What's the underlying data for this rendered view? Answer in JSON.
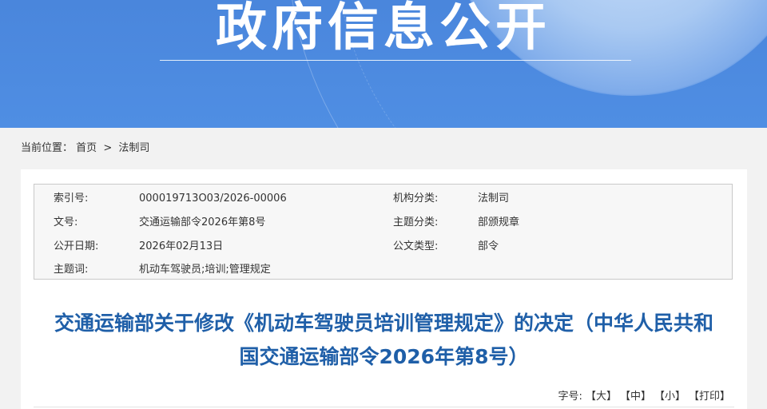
{
  "banner": {
    "title": "政府信息公开"
  },
  "breadcrumb": {
    "label": "当前位置：",
    "home": "首页",
    "sep": ">",
    "current": "法制司"
  },
  "meta": {
    "index_label": "索引号:",
    "index_value": "000019713O03/2026-00006",
    "org_label": "机构分类:",
    "org_value": "法制司",
    "docno_label": "文号:",
    "docno_value": "交通运输部令2026年第8号",
    "topic_label": "主题分类:",
    "topic_value": "部颁规章",
    "date_label": "公开日期:",
    "date_value": "2026年02月13日",
    "type_label": "公文类型:",
    "type_value": "部令",
    "keywords_label": "主题词:",
    "keywords_value": "机动车驾驶员;培训;管理规定"
  },
  "document": {
    "title_line1": "交通运输部关于修改《机动车驾驶员培训管理规定》的决定（中华人民共和",
    "title_line2": "国交通运输部令2026年第8号）"
  },
  "font_tools": {
    "label": "字号:",
    "large": "【大】",
    "medium": "【中】",
    "small": "【小】",
    "print": "【打印】"
  }
}
